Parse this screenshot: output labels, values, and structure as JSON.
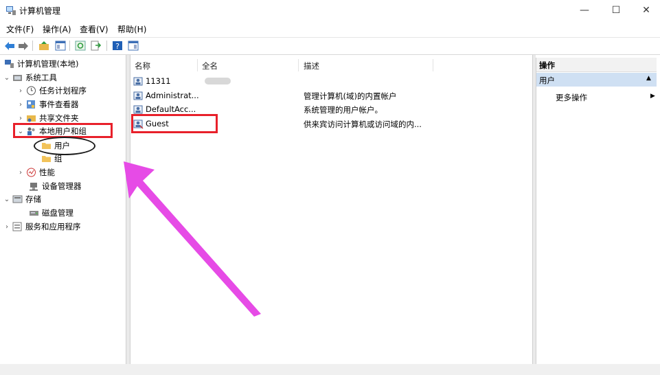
{
  "window": {
    "title": "计算机管理",
    "min_symbol": "—",
    "max_symbol": "☐",
    "close_symbol": "✕"
  },
  "menu": [
    {
      "label": "文件(F)"
    },
    {
      "label": "操作(A)"
    },
    {
      "label": "查看(V)"
    },
    {
      "label": "帮助(H)"
    }
  ],
  "toolbar": {
    "icons": [
      "back-arrow-icon",
      "forward-arrow-icon",
      "up-folder-icon",
      "show-tree-icon",
      "refresh-icon",
      "export-list-icon",
      "help-icon",
      "properties-icon"
    ]
  },
  "tree": {
    "root": "计算机管理(本地)",
    "system_tools": "系统工具",
    "task_scheduler": "任务计划程序",
    "event_viewer": "事件查看器",
    "shared_folders": "共享文件夹",
    "local_users_groups": "本地用户和组",
    "users": "用户",
    "groups": "组",
    "performance": "性能",
    "device_manager": "设备管理器",
    "storage": "存储",
    "disk_management": "磁盘管理",
    "services_apps": "服务和应用程序"
  },
  "list": {
    "headers": {
      "name": "名称",
      "fullname": "全名",
      "description": "描述"
    },
    "rows": [
      {
        "name": "11311",
        "fullname": "",
        "description": ""
      },
      {
        "name": "Administrat...",
        "fullname": "",
        "description": "管理计算机(域)的内置帐户"
      },
      {
        "name": "DefaultAcc...",
        "fullname": "",
        "description": "系统管理的用户帐户。"
      },
      {
        "name": "Guest",
        "fullname": "",
        "description": "供来宾访问计算机或访问域的内..."
      }
    ]
  },
  "actions": {
    "title": "操作",
    "section": "用户",
    "more": "更多操作",
    "collapse_symbol": "▲",
    "more_symbol": "▶"
  },
  "colors": {
    "annotation_red": "#e8202a",
    "annotation_magenta": "#e64be6",
    "selection_blue": "#cfe0f3"
  }
}
